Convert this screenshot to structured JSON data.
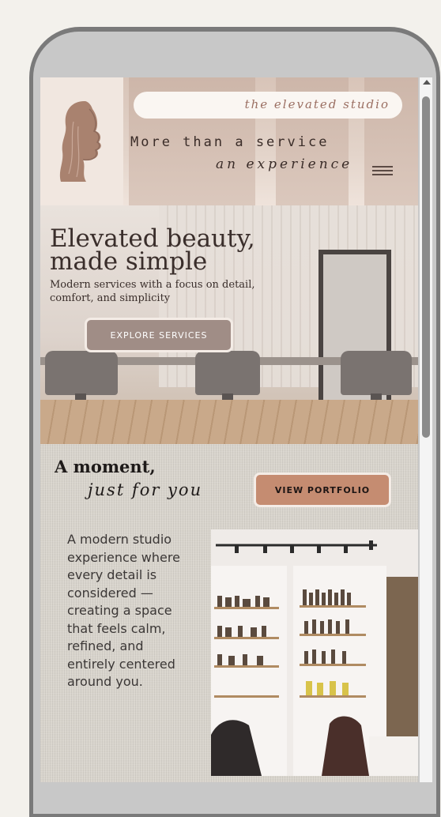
{
  "header": {
    "tagline": "the elevated studio",
    "line1": "More than a service",
    "line2": "an experience"
  },
  "hero": {
    "title_line1": "Elevated beauty,",
    "title_line2": "made simple",
    "subtitle": "Modern services with a focus on detail, comfort, and simplicity",
    "cta_label": "EXPLORE SERVICES"
  },
  "moment": {
    "title": "A moment,",
    "script": "just for you",
    "cta_label": "VIEW PORTFOLIO",
    "body": "A modern studio experience where every detail is considered — creating a space that feels calm, refined, and entirely centered around you."
  },
  "icons": {
    "logo": "woman-silhouette-icon",
    "menu": "hamburger-menu-icon",
    "scroll_up": "scroll-up-arrow-icon"
  },
  "colors": {
    "accent": "#c58c71",
    "explore_button": "#a08d86",
    "tagline_text": "#9b6f62",
    "text_dark": "#3a2e2b"
  }
}
